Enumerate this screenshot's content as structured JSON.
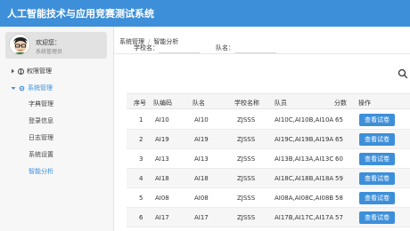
{
  "app": {
    "title": "人工智能技术与应用竞赛测试系统"
  },
  "user": {
    "greeting": "欢迎您：",
    "role": "系统管理员"
  },
  "sidebar": {
    "groups": [
      {
        "label": "权限管理",
        "expanded": false,
        "icon": "shield-icon"
      },
      {
        "label": "系统管理",
        "expanded": true,
        "icon": "gear-icon"
      }
    ],
    "items": [
      {
        "label": "字典管理"
      },
      {
        "label": "登录信息"
      },
      {
        "label": "日志管理"
      },
      {
        "label": "系统设置"
      },
      {
        "label": "智能分析",
        "active": true
      }
    ]
  },
  "breadcrumb": {
    "root": "系统管理",
    "separator": "/",
    "current": "智能分析"
  },
  "filters": {
    "school_label": "学校名：",
    "team_label": "队名：",
    "school_value": "",
    "team_value": ""
  },
  "table": {
    "headers": [
      "序号",
      "队编码",
      "队名",
      "学校名称",
      "队员",
      "分数",
      "操作"
    ],
    "rows": [
      {
        "no": "1",
        "code": "AI10",
        "name": "AI10",
        "school": "ZJSSS",
        "members": "AI10C,AI10B,AI10A",
        "score": "65",
        "action": "查看试卷"
      },
      {
        "no": "2",
        "code": "AI19",
        "name": "AI19",
        "school": "ZJSSS",
        "members": "AI19C,AI19B,AI19A",
        "score": "65",
        "action": "查看试卷"
      },
      {
        "no": "3",
        "code": "AI13",
        "name": "AI13",
        "school": "ZJSSS",
        "members": "AI13B,AI13A,AI13C",
        "score": "60",
        "action": "查看试卷"
      },
      {
        "no": "4",
        "code": "AI18",
        "name": "AI18",
        "school": "ZJSSS",
        "members": "AI18C,AI18B,AI18A",
        "score": "59",
        "action": "查看试卷"
      },
      {
        "no": "5",
        "code": "AI08",
        "name": "AI08",
        "school": "ZJSSS",
        "members": "AI08A,AI08C,AI08B",
        "score": "58",
        "action": "查看试卷"
      },
      {
        "no": "6",
        "code": "AI17",
        "name": "AI17",
        "school": "ZJSSS",
        "members": "AI17B,AI17C,AI17A",
        "score": "57",
        "action": "查看试卷"
      }
    ]
  },
  "colors": {
    "primary": "#3d8fd9",
    "header_bg": "#f5f5f5",
    "alt_row": "#f6f6f6"
  }
}
